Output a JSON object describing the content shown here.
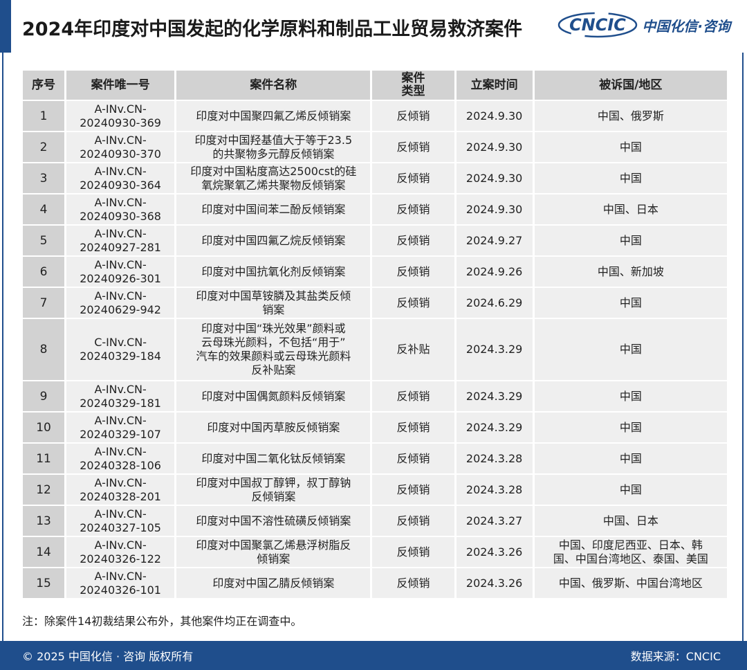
{
  "header": {
    "title": "2024年印度对中国发起的化学原料和制品工业贸易救济案件",
    "logo_text": "中国化信·咨询",
    "logo_brand": "CNCIC",
    "accent_color": "#1f4e8c"
  },
  "table": {
    "columns": [
      "序号",
      "案件唯一号",
      "案件名称",
      "案件\n类型",
      "立案时间",
      "被诉国/地区"
    ],
    "rows": [
      {
        "seq": "1",
        "id": "A-INv.CN-\n20240930-369",
        "name": "印度对中国聚四氟乙烯反倾销案",
        "type": "反倾销",
        "date": "2024.9.30",
        "region": "中国、俄罗斯"
      },
      {
        "seq": "2",
        "id": "A-INv.CN-\n20240930-370",
        "name": "印度对中国羟基值大于等于23.5\n的共聚物多元醇反倾销案",
        "type": "反倾销",
        "date": "2024.9.30",
        "region": "中国"
      },
      {
        "seq": "3",
        "id": "A-INv.CN-\n20240930-364",
        "name": "印度对中国粘度高达2500cst的硅\n氧烷聚氧乙烯共聚物反倾销案",
        "type": "反倾销",
        "date": "2024.9.30",
        "region": "中国"
      },
      {
        "seq": "4",
        "id": "A-INv.CN-\n20240930-368",
        "name": "印度对中国间苯二酚反倾销案",
        "type": "反倾销",
        "date": "2024.9.30",
        "region": "中国、日本"
      },
      {
        "seq": "5",
        "id": "A-INv.CN-\n20240927-281",
        "name": "印度对中国四氟乙烷反倾销案",
        "type": "反倾销",
        "date": "2024.9.27",
        "region": "中国"
      },
      {
        "seq": "6",
        "id": "A-INv.CN-\n20240926-301",
        "name": "印度对中国抗氧化剂反倾销案",
        "type": "反倾销",
        "date": "2024.9.26",
        "region": "中国、新加坡"
      },
      {
        "seq": "7",
        "id": "A-INv.CN-\n20240629-942",
        "name": "印度对中国草铵膦及其盐类反倾\n销案",
        "type": "反倾销",
        "date": "2024.6.29",
        "region": "中国"
      },
      {
        "seq": "8",
        "id": "C-INv.CN-\n20240329-184",
        "name": "印度对中国“珠光效果”颜料或\n云母珠光颜料，不包括“用于”\n汽车的效果颜料或云母珠光颜料\n反补贴案",
        "type": "反补贴",
        "date": "2024.3.29",
        "region": "中国"
      },
      {
        "seq": "9",
        "id": "A-INv.CN-\n20240329-181",
        "name": "印度对中国偶氮颜料反倾销案",
        "type": "反倾销",
        "date": "2024.3.29",
        "region": "中国"
      },
      {
        "seq": "10",
        "id": "A-INv.CN-\n20240329-107",
        "name": "印度对中国丙草胺反倾销案",
        "type": "反倾销",
        "date": "2024.3.29",
        "region": "中国"
      },
      {
        "seq": "11",
        "id": "A-INv.CN-\n20240328-106",
        "name": "印度对中国二氧化钛反倾销案",
        "type": "反倾销",
        "date": "2024.3.28",
        "region": "中国"
      },
      {
        "seq": "12",
        "id": "A-INv.CN-\n20240328-201",
        "name": "印度对中国叔丁醇钾，叔丁醇钠\n反倾销案",
        "type": "反倾销",
        "date": "2024.3.28",
        "region": "中国"
      },
      {
        "seq": "13",
        "id": "A-INv.CN-\n20240327-105",
        "name": "印度对中国不溶性硫磺反倾销案",
        "type": "反倾销",
        "date": "2024.3.27",
        "region": "中国、日本"
      },
      {
        "seq": "14",
        "id": "A-INv.CN-\n20240326-122",
        "name": "印度对中国聚氯乙烯悬浮树脂反\n倾销案",
        "type": "反倾销",
        "date": "2024.3.26",
        "region": "中国、印度尼西亚、日本、韩\n国、中国台湾地区、泰国、美国"
      },
      {
        "seq": "15",
        "id": "A-INv.CN-\n20240326-101",
        "name": "印度对中国乙腈反倾销案",
        "type": "反倾销",
        "date": "2024.3.26",
        "region": "中国、俄罗斯、中国台湾地区"
      }
    ]
  },
  "note": "注：除案件14初裁结果公布外，其他案件均正在调查中。",
  "footer": {
    "copyright": "© 2025 中国化信 · 咨询  版权所有",
    "source": "数据来源：CNCIC"
  }
}
